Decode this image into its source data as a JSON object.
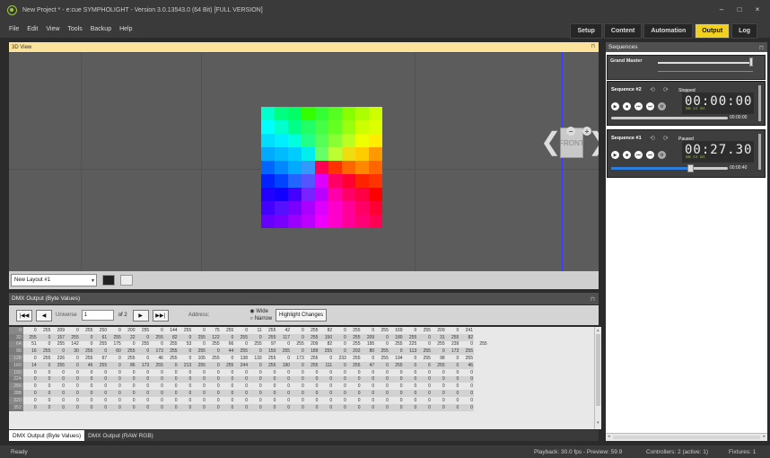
{
  "window": {
    "title": "New Project * - e:cue SYMPHOLIGHT - Version 3.0.13543.0 (64 Bit) [FULL VERSION]",
    "minimize": "–",
    "maximize": "□",
    "close": "×"
  },
  "menu": [
    "File",
    "Edit",
    "View",
    "Tools",
    "Backup",
    "Help"
  ],
  "tabs": [
    "Setup",
    "Content",
    "Automation",
    "Output",
    "Log"
  ],
  "active_tab": "Output",
  "view3d": {
    "title": "3D View",
    "front_label": "FRONT",
    "grid_colors": [
      [
        "#00ffcc",
        "#00ff80",
        "#00ff66",
        "#33ff00",
        "#33ff33",
        "#55ff22",
        "#88ff00",
        "#aaff00",
        "#ccff00"
      ],
      [
        "#00ffff",
        "#00ffcc",
        "#00ff88",
        "#22ff66",
        "#44ff44",
        "#66ff22",
        "#99ff11",
        "#ccff00",
        "#ddff00"
      ],
      [
        "#00ddff",
        "#00eeff",
        "#00ffdd",
        "#22ff88",
        "#55ff55",
        "#88ff33",
        "#bbff22",
        "#eeff00",
        "#ffee00"
      ],
      [
        "#00aaff",
        "#00bbff",
        "#00ccff",
        "#00eeee",
        "#66ff66",
        "#bbff33",
        "#eedd11",
        "#ffcc00",
        "#ff9900"
      ],
      [
        "#0066ff",
        "#0088ff",
        "#00aaff",
        "#3399ff",
        "#ff0055",
        "#ff3300",
        "#ff6600",
        "#ff8800",
        "#ff6600"
      ],
      [
        "#0022ff",
        "#0044ff",
        "#2266ff",
        "#5555ff",
        "#dd00ff",
        "#ff0066",
        "#ff0033",
        "#ff2200",
        "#ff3300"
      ],
      [
        "#2200ff",
        "#1100ff",
        "#4400ff",
        "#7722ff",
        "#bb00ff",
        "#ff00aa",
        "#ff0066",
        "#ff0044",
        "#ff0000"
      ],
      [
        "#4400ff",
        "#5511ff",
        "#7700ff",
        "#aa00ff",
        "#dd00ff",
        "#ff00cc",
        "#ff0099",
        "#ff0066",
        "#ff0033"
      ],
      [
        "#6600ff",
        "#7700ff",
        "#9900ff",
        "#bb00ff",
        "#ee00ff",
        "#ff00cc",
        "#ff0099",
        "#ff0077",
        "#ff0055"
      ]
    ]
  },
  "layout_select": "New Layout #1",
  "dmx": {
    "title": "DMX Output (Byte Values)",
    "universe_label": "Universe",
    "universe_value": "1",
    "of_label": "of 2",
    "address_label": "Address:",
    "wide": "Wide",
    "narrow": "Narrow",
    "highlight_btn": "Highlight Changes",
    "row_labels": [
      "0:",
      "32:",
      "64:",
      "96:",
      "128:",
      "160:",
      "192:",
      "224:",
      "256:",
      "288:",
      "320:",
      "352:"
    ],
    "rows": [
      [
        "0",
        "255",
        "209",
        "0",
        "255",
        "250",
        "0",
        "200",
        "255",
        "0",
        "144",
        "255",
        "0",
        "75",
        "255",
        "0",
        "11",
        "255",
        "42",
        "0",
        "255",
        "82",
        "0",
        "255",
        "0",
        "255",
        "169",
        "0",
        "255",
        "209",
        "0",
        "241"
      ],
      [
        "255",
        "0",
        "157",
        "255",
        "0",
        "61",
        "255",
        "22",
        "0",
        "255",
        "82",
        "0",
        "255",
        "122",
        "0",
        "255",
        "0",
        "255",
        "117",
        "0",
        "255",
        "150",
        "0",
        "255",
        "209",
        "0",
        "180",
        "255",
        "0",
        "31",
        "255",
        "82"
      ],
      [
        "51",
        "0",
        "255",
        "142",
        "0",
        "255",
        "175",
        "0",
        "255",
        "0",
        "255",
        "53",
        "0",
        "255",
        "66",
        "0",
        "255",
        "97",
        "0",
        "255",
        "209",
        "82",
        "0",
        "255",
        "195",
        "0",
        "255",
        "225",
        "0",
        "255",
        "239",
        "0",
        "255"
      ],
      [
        "16",
        "255",
        "0",
        "30",
        "255",
        "0",
        "60",
        "255",
        "0",
        "173",
        "255",
        "0",
        "255",
        "0",
        "44",
        "255",
        "0",
        "150",
        "255",
        "0",
        "189",
        "255",
        "0",
        "202",
        "80",
        "255",
        "0",
        "113",
        "255",
        "0",
        "173",
        "255"
      ],
      [
        "0",
        "255",
        "226",
        "0",
        "255",
        "67",
        "0",
        "255",
        "0",
        "46",
        "255",
        "0",
        "105",
        "255",
        "0",
        "138",
        "133",
        "255",
        "0",
        "173",
        "255",
        "0",
        "233",
        "255",
        "0",
        "255",
        "194",
        "0",
        "255",
        "98",
        "0",
        "255"
      ],
      [
        "14",
        "0",
        "255",
        "0",
        "46",
        "255",
        "0",
        "86",
        "173",
        "255",
        "0",
        "213",
        "255",
        "0",
        "255",
        "244",
        "0",
        "255",
        "190",
        "0",
        "255",
        "111",
        "0",
        "255",
        "47",
        "0",
        "255",
        "0",
        "6",
        "255",
        "0",
        "46"
      ],
      [
        "0",
        "0",
        "0",
        "0",
        "0",
        "0",
        "0",
        "0",
        "0",
        "0",
        "0",
        "0",
        "0",
        "0",
        "0",
        "0",
        "0",
        "0",
        "0",
        "0",
        "0",
        "0",
        "0",
        "0",
        "0",
        "0",
        "0",
        "0",
        "0",
        "0",
        "0",
        "0"
      ],
      [
        "0",
        "0",
        "0",
        "0",
        "0",
        "0",
        "0",
        "0",
        "0",
        "0",
        "0",
        "0",
        "0",
        "0",
        "0",
        "0",
        "0",
        "0",
        "0",
        "0",
        "0",
        "0",
        "0",
        "0",
        "0",
        "0",
        "0",
        "0",
        "0",
        "0",
        "0",
        "0"
      ],
      [
        "0",
        "0",
        "0",
        "0",
        "0",
        "0",
        "0",
        "0",
        "0",
        "0",
        "0",
        "0",
        "0",
        "0",
        "0",
        "0",
        "0",
        "0",
        "0",
        "0",
        "0",
        "0",
        "0",
        "0",
        "0",
        "0",
        "0",
        "0",
        "0",
        "0",
        "0",
        "0"
      ],
      [
        "0",
        "0",
        "0",
        "0",
        "0",
        "0",
        "0",
        "0",
        "0",
        "0",
        "0",
        "0",
        "0",
        "0",
        "0",
        "0",
        "0",
        "0",
        "0",
        "0",
        "0",
        "0",
        "0",
        "0",
        "0",
        "0",
        "0",
        "0",
        "0",
        "0",
        "0",
        "0"
      ],
      [
        "0",
        "0",
        "0",
        "0",
        "0",
        "0",
        "0",
        "0",
        "0",
        "0",
        "0",
        "0",
        "0",
        "0",
        "0",
        "0",
        "0",
        "0",
        "0",
        "0",
        "0",
        "0",
        "0",
        "0",
        "0",
        "0",
        "0",
        "0",
        "0",
        "0",
        "0",
        "0"
      ],
      [
        "0",
        "0",
        "0",
        "0",
        "0",
        "0",
        "0",
        "0",
        "0",
        "0",
        "0",
        "0",
        "0",
        "0",
        "0",
        "0",
        "0",
        "0",
        "0",
        "0",
        "0",
        "0",
        "0",
        "0",
        "0",
        "0",
        "0",
        "0",
        "0",
        "0",
        "0",
        "0"
      ]
    ],
    "bottom_tabs": [
      "DMX Output (Byte Values)",
      "DMX Output (RAW RGB)"
    ]
  },
  "sequences": {
    "title": "Sequences",
    "grand_master": "Grand Master",
    "items": [
      {
        "name": "Sequence #2",
        "status": "Stopped",
        "time": "00:00:00",
        "units": "mm    ss    ms",
        "end": "00:00:00",
        "progress": 0
      },
      {
        "name": "Sequence #1",
        "status": "Paused",
        "time": "00:27.30",
        "units": "mm    ss    ms",
        "end": "00:00:40",
        "progress": 0.68
      }
    ]
  },
  "status": {
    "left": "Ready",
    "playback": "Playback: 30.0 fps - Preview: 59.9",
    "controllers": "Controllers: 2 (active: 1)",
    "fixtures": "Fixtures: 1"
  }
}
